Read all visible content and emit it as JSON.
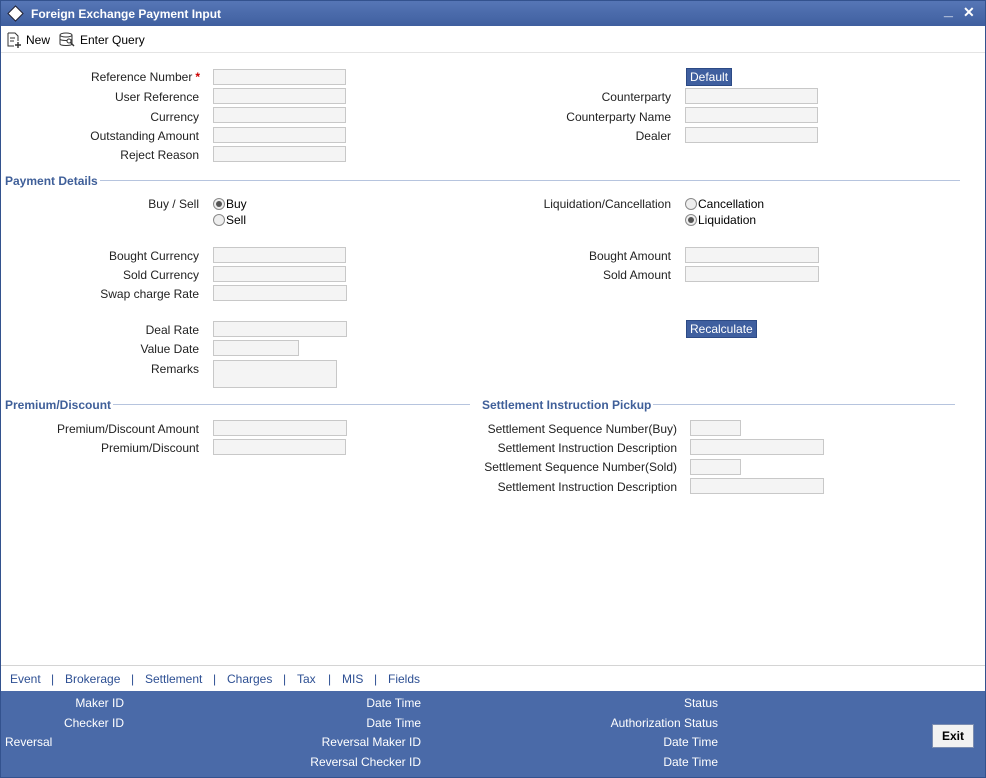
{
  "window": {
    "title": "Foreign Exchange Payment Input",
    "minimize_glyph": "_",
    "close_glyph": "✕"
  },
  "toolbar": {
    "new_label": "New",
    "enter_query_label": "Enter Query"
  },
  "header": {
    "reference_number": "Reference Number",
    "required_mark": "*",
    "user_reference": "User Reference",
    "currency": "Currency",
    "outstanding_amount": "Outstanding Amount",
    "reject_reason": "Reject Reason",
    "default_button": "Default",
    "counterparty": "Counterparty",
    "counterparty_name": "Counterparty Name",
    "dealer": "Dealer"
  },
  "payment": {
    "section_title": "Payment Details",
    "buy_sell_label": "Buy / Sell",
    "buy": "Buy",
    "sell": "Sell",
    "buy_sell_selected": "Buy",
    "liq_canc_label": "Liquidation/Cancellation",
    "cancellation": "Cancellation",
    "liquidation": "Liquidation",
    "liq_canc_selected": "Liquidation",
    "bought_currency": "Bought Currency",
    "sold_currency": "Sold Currency",
    "swap_charge_rate": "Swap charge Rate",
    "bought_amount": "Bought Amount",
    "sold_amount": "Sold Amount",
    "deal_rate": "Deal Rate",
    "value_date": "Value Date",
    "remarks": "Remarks",
    "recalculate_button": "Recalculate"
  },
  "premium": {
    "section_title": "Premium/Discount",
    "amount": "Premium/Discount Amount",
    "premium_discount": "Premium/Discount"
  },
  "settlement": {
    "section_title": "Settlement Instruction Pickup",
    "seq_buy": "Settlement Sequence Number(Buy)",
    "desc_1": "Settlement Instruction Description",
    "seq_sold": "Settlement Sequence Number(Sold)",
    "desc_2": "Settlement Instruction Description"
  },
  "tabs": [
    "Event",
    "Brokerage",
    "Settlement",
    "Charges",
    "Tax",
    "MIS",
    "Fields"
  ],
  "tab_separator": "|",
  "footer": {
    "maker_id": "Maker ID",
    "checker_id": "Checker ID",
    "reversal": "Reversal",
    "date_time": "Date Time",
    "reversal_maker_id": "Reversal Maker ID",
    "reversal_checker_id": "Reversal Checker ID",
    "status": "Status",
    "authorization_status": "Authorization Status",
    "exit_button": "Exit"
  },
  "colors": {
    "titlebar": "#4a6aa8",
    "section": "#3f5f99",
    "tab_link": "#2d4f93",
    "required": "#cc0000"
  },
  "icons": {
    "logo": "diamond-logo-icon",
    "new": "new-document-icon",
    "enter_query": "enter-query-icon"
  }
}
